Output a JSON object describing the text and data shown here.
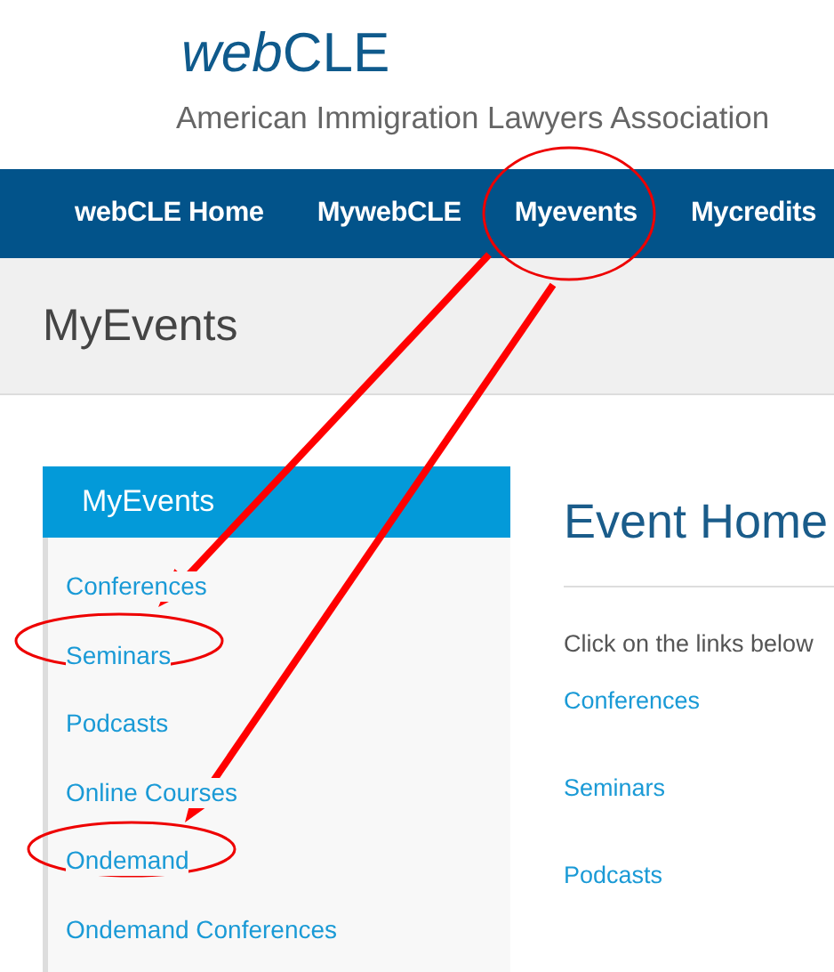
{
  "header": {
    "logo_italic": "web",
    "logo_rest": "CLE",
    "subtitle": "American Immigration Lawyers Association"
  },
  "nav": [
    "webCLE Home",
    "MywebCLE",
    "Myevents",
    "Mycredits"
  ],
  "page_title": "MyEvents",
  "sidebar": {
    "title": "MyEvents",
    "items": [
      "Conferences",
      "Seminars",
      "Podcasts",
      "Online Courses",
      "Ondemand",
      "Ondemand Conferences"
    ]
  },
  "main": {
    "title": "Event Home",
    "intro": "Click on the links below",
    "links": [
      "Conferences",
      "Seminars",
      "Podcasts"
    ]
  }
}
